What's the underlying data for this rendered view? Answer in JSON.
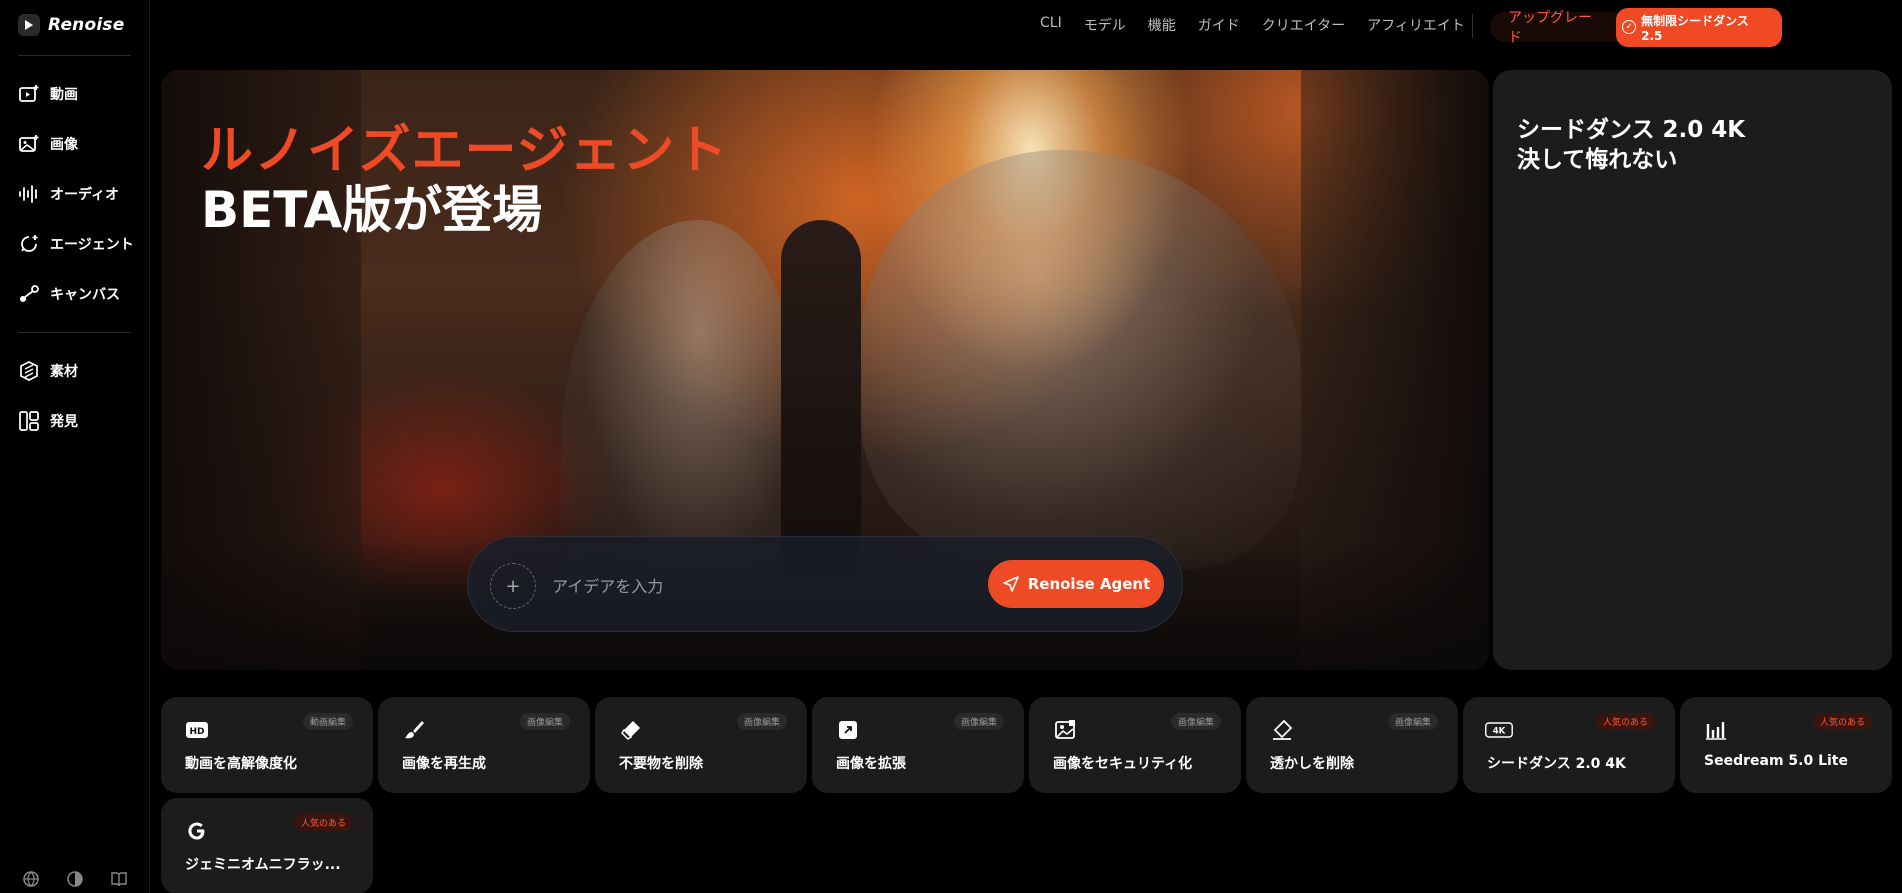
{
  "sidebar": {
    "logo_text": "Renoise",
    "items": [
      {
        "label": "動画",
        "icon": "video-plus-icon"
      },
      {
        "label": "画像",
        "icon": "image-plus-icon"
      },
      {
        "label": "オーディオ",
        "icon": "audio-wave-icon"
      },
      {
        "label": "エージェント",
        "icon": "agent-chat-icon"
      },
      {
        "label": "キャンバス",
        "icon": "canvas-nodes-icon"
      },
      {
        "label": "素材",
        "icon": "assets-icon"
      },
      {
        "label": "発見",
        "icon": "discover-grid-icon"
      }
    ],
    "bottom_icons": [
      "globe-icon",
      "theme-icon",
      "book-icon"
    ]
  },
  "topnav": {
    "links": [
      "CLI",
      "モデル",
      "機能",
      "ガイド",
      "クリエイター",
      "アフィリエイト"
    ],
    "upgrade_label": "アップグレード",
    "promo_pill": "無制限シードダンス 2.5"
  },
  "hero": {
    "title_line1": "ルノイズエージェント",
    "title_line2": "BETA版が登場",
    "prompt_placeholder": "アイデアを入力",
    "agent_button": "Renoise Agent"
  },
  "promo": {
    "line1": "シードダンス 2.0 4K",
    "line2": "決して悔れない"
  },
  "tools": [
    {
      "label": "動画を高解像度化",
      "tag": "動画編集",
      "hot": false,
      "icon": "hd-icon"
    },
    {
      "label": "画像を再生成",
      "tag": "画像編集",
      "hot": false,
      "icon": "brush-icon"
    },
    {
      "label": "不要物を削除",
      "tag": "画像編集",
      "hot": false,
      "icon": "eraser-icon"
    },
    {
      "label": "画像を拡張",
      "tag": "画像編集",
      "hot": false,
      "icon": "expand-icon"
    },
    {
      "label": "画像をセキュリティ化",
      "tag": "画像編集",
      "hot": false,
      "icon": "image-secure-icon"
    },
    {
      "label": "透かしを削除",
      "tag": "画像編集",
      "hot": false,
      "icon": "watermark-eraser-icon"
    },
    {
      "label": "シードダンス 2.0 4K",
      "tag": "人気のある",
      "hot": true,
      "icon": "4k-icon"
    },
    {
      "label": "Seedream 5.0 Lite",
      "tag": "人気のある",
      "hot": true,
      "icon": "bars-icon"
    },
    {
      "label": "ジェミニオムニフラッ...",
      "tag": "人気のある",
      "hot": true,
      "icon": "google-g-icon"
    }
  ],
  "colors": {
    "accent": "#ef4a26",
    "card_bg": "#1c1c1c",
    "bg": "#000000"
  }
}
